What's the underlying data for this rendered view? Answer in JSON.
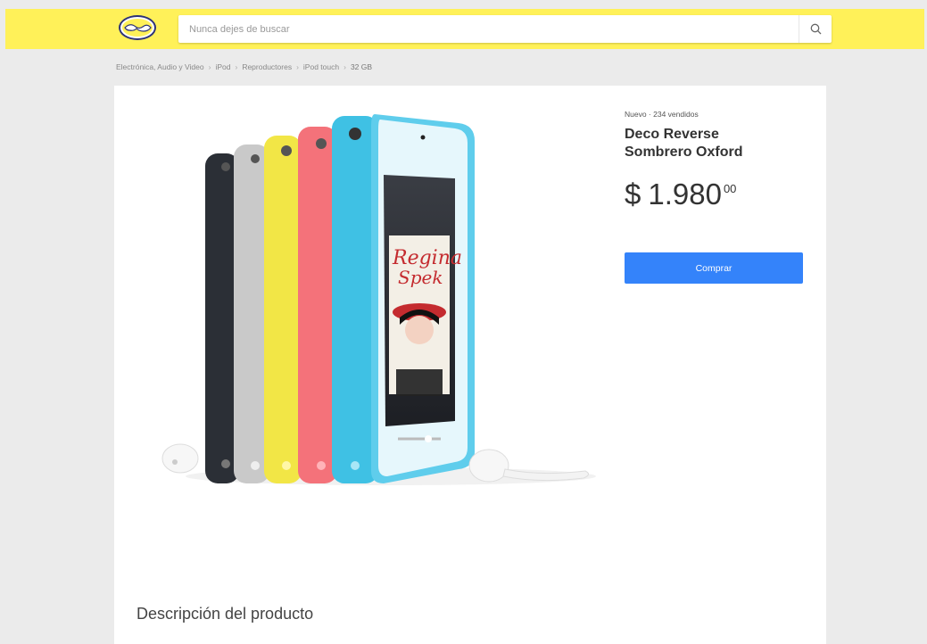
{
  "header": {
    "search": {
      "placeholder": "Nunca dejes de buscar"
    },
    "icons": {
      "logo": "handshake-logo",
      "search": "search-icon"
    }
  },
  "breadcrumb": {
    "items": [
      "Electrónica, Audio y Video",
      "iPod",
      "Reproductores",
      "iPod touch",
      "32 GB"
    ]
  },
  "product": {
    "condition": "Nuevo · 234 vendidos",
    "title": "Deco Reverse Sombrero Oxford",
    "price": {
      "currency": "$",
      "amount": "1.980",
      "cents": "00"
    },
    "buy_label": "Comprar",
    "image_subject": "ipod-touch-colors"
  },
  "description": {
    "title": "Descripción del producto"
  },
  "colors": {
    "header_bg": "#fff159",
    "page_bg": "#ebebeb",
    "button": "#3483fa",
    "ipod_black": "#2b2f36",
    "ipod_silver": "#c9c9c9",
    "ipod_yellow": "#f2e646",
    "ipod_pink": "#f4727a",
    "ipod_blue": "#3fc1e4"
  }
}
